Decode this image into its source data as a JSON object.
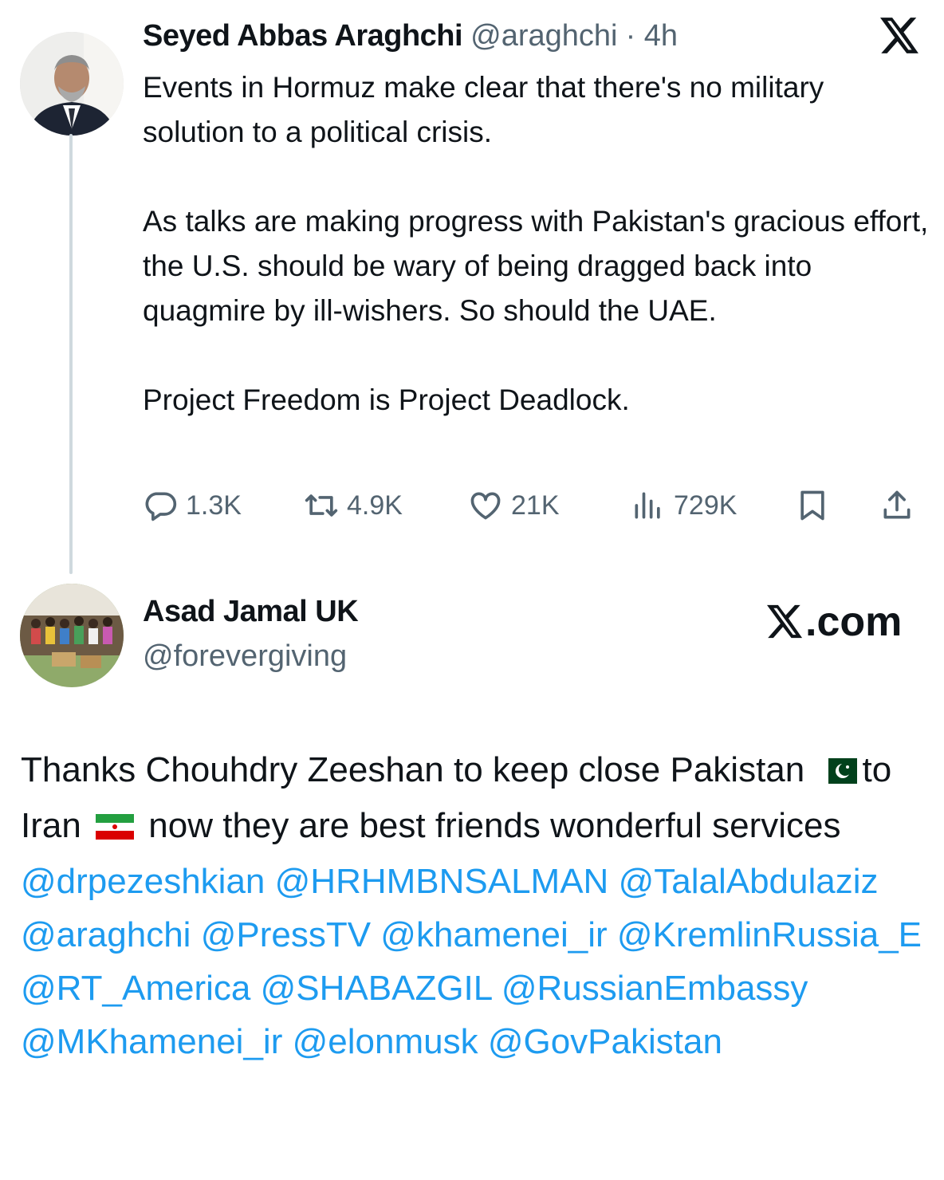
{
  "tweet1": {
    "author_name": "Seyed Abbas Araghchi",
    "handle": "@araghchi",
    "time": "· 4h",
    "paragraphs": [
      "Events in Hormuz make clear that there's no military solution to a political crisis.",
      "As talks are making progress with Pakistan's gracious effort, the U.S. should be wary of being dragged back into quagmire by ill-wishers. So should the UAE.",
      "Project Freedom is Project Deadlock."
    ],
    "stats": {
      "replies": "1.3K",
      "reposts": "4.9K",
      "likes": "21K",
      "views": "729K"
    }
  },
  "reply": {
    "author_name": "Asad Jamal UK",
    "handle": "@forevergiving",
    "watermark": ".com",
    "text": {
      "t1": "Thanks Chouhdry Zeeshan to keep close Pakistan",
      "t2": "to Iran",
      "t3": "now they are best friends wonderful services",
      "mentions": [
        "@drpezeshkian",
        "@HRHMBNSALMAN",
        "@TalalAbdulaziz",
        "@araghchi",
        "@PressTV",
        "@khamenei_ir",
        "@KremlinRussia_E",
        "@RT_America",
        "@SHABAZGIL",
        "@RussianEmbassy",
        "@MKhamenei_ir",
        "@elonmusk",
        "@GovPakistan"
      ]
    }
  },
  "colors": {
    "text": "#0f1419",
    "muted": "#536471",
    "accent": "#1d9bf0",
    "thread_line": "#cfd9de"
  },
  "icons": [
    "x-logo-icon",
    "reply-icon",
    "repost-icon",
    "like-icon",
    "views-icon",
    "bookmark-icon",
    "share-icon",
    "pakistan-flag-icon",
    "iran-flag-icon"
  ]
}
